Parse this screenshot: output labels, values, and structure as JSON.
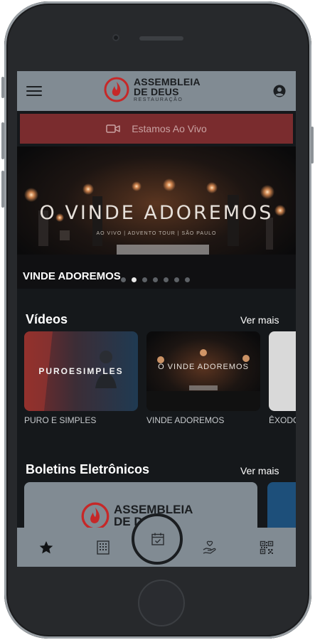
{
  "header": {
    "brand_line1": "ASSEMBLEIA",
    "brand_line2": "DE DEUS",
    "brand_sub": "RESTAURAÇÃO",
    "menu_icon": "hamburger-icon",
    "account_icon": "account-circle-icon"
  },
  "live": {
    "label": "Estamos Ao Vivo",
    "icon": "video-camera-icon"
  },
  "hero": {
    "banner_title": "O VINDE ADOREMOS",
    "banner_subtitle": "AO VIVO | ADVENTO TOUR | SÃO PAULO",
    "caption": "VINDE ADOREMOS",
    "slide_count": 7,
    "active_slide": 1
  },
  "videos": {
    "title": "Vídeos",
    "see_more": "Ver mais",
    "items": [
      {
        "label": "PURO E SIMPLES",
        "thumb_text": "PUROESIMPLES"
      },
      {
        "label": "VINDE ADOREMOS",
        "thumb_text": "O VINDE ADOREMOS"
      },
      {
        "label": "ÊXODO"
      }
    ]
  },
  "bulletins": {
    "title": "Boletins Eletrônicos",
    "see_more": "Ver mais",
    "card_line1": "ASSEMBLEIA",
    "card_line2": "DE DEUS"
  },
  "bottom_nav": [
    {
      "name": "favorites",
      "icon": "star-icon"
    },
    {
      "name": "buildings",
      "icon": "building-icon"
    },
    {
      "name": "calendar",
      "icon": "calendar-check-icon"
    },
    {
      "name": "donate",
      "icon": "hand-heart-icon"
    },
    {
      "name": "qrcode",
      "icon": "qr-code-icon"
    }
  ],
  "colors": {
    "header_bg": "#818b93",
    "live_bar": "#7a2c2e",
    "brand_red": "#c62828",
    "screen_bg": "#15181b"
  }
}
